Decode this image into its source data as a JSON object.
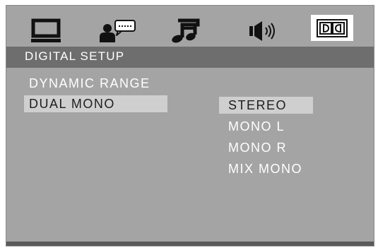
{
  "tabs": [
    {
      "icon": "monitor-icon",
      "active": false
    },
    {
      "icon": "user-subtitle-icon",
      "active": false
    },
    {
      "icon": "music-note-icon",
      "active": false
    },
    {
      "icon": "speaker-icon",
      "active": false
    },
    {
      "icon": "dolby-digital-icon",
      "active": true
    }
  ],
  "header": {
    "title": "DIGITAL SETUP"
  },
  "menu": {
    "items": [
      {
        "label": "DYNAMIC RANGE",
        "selected": false
      },
      {
        "label": "DUAL MONO",
        "selected": true
      }
    ]
  },
  "options": {
    "items": [
      {
        "label": "STEREO",
        "selected": true
      },
      {
        "label": "MONO L",
        "selected": false
      },
      {
        "label": "MONO R",
        "selected": false
      },
      {
        "label": "MIX MONO",
        "selected": false
      }
    ]
  },
  "colors": {
    "panel": "#a4a4a4",
    "header": "#6e6e6e",
    "highlight": "#cfcfcf",
    "text": "#ffffff",
    "icon": "#111111"
  }
}
